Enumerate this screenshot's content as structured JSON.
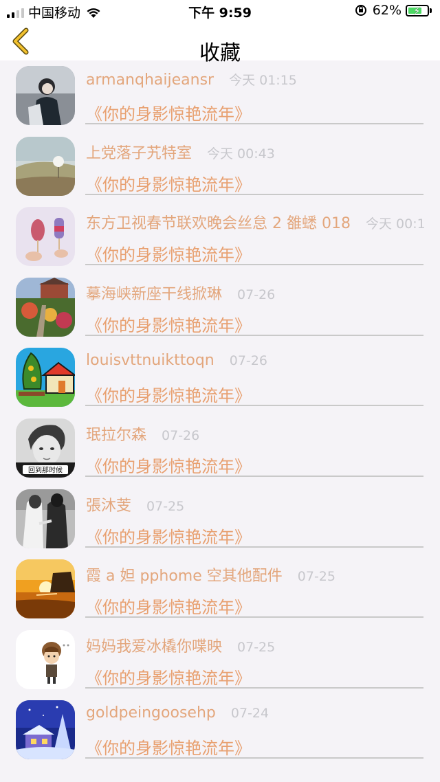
{
  "status_bar": {
    "carrier": "中国移动",
    "time": "下午 9:59",
    "battery_percent": "62%"
  },
  "nav": {
    "title": "收藏"
  },
  "favorites": [
    {
      "name": "armanqhaijeansr",
      "date": "今天 01:15",
      "song": "《你的身影惊艳流年》"
    },
    {
      "name": "上党落子艽特室",
      "date": "今天 00:43",
      "song": "《你的身影惊艳流年》"
    },
    {
      "name": "东方卫视春节联欢晚会丝怠 2 雒蟋 018",
      "date": "今天 00:1",
      "song": "《你的身影惊艳流年》"
    },
    {
      "name": "摹海峡新座干线掀琳",
      "date": "07-26",
      "song": "《你的身影惊艳流年》"
    },
    {
      "name": "louisvttnuikttoqn",
      "date": "07-26",
      "song": "《你的身影惊艳流年》"
    },
    {
      "name": "珉拉尔森",
      "date": "07-26",
      "song": "《你的身影惊艳流年》"
    },
    {
      "name": "張沐芰",
      "date": "07-25",
      "song": "《你的身影惊艳流年》"
    },
    {
      "name": "霞 a 妲 pphome 空其他配件",
      "date": "07-25",
      "song": "《你的身影惊艳流年》"
    },
    {
      "name": "妈妈我爱冰橇你喋映",
      "date": "07-25",
      "song": "《你的身影惊艳流年》"
    },
    {
      "name": "goldpeingoosehp",
      "date": "07-24",
      "song": "《你的身影惊艳流年》"
    }
  ],
  "avatar_badge_text": "回到那时候",
  "colors": {
    "accent": "#e8a070",
    "date_gray": "#c7c7cc",
    "background": "#f5f3f7",
    "back_arrow": "#c9a227"
  }
}
